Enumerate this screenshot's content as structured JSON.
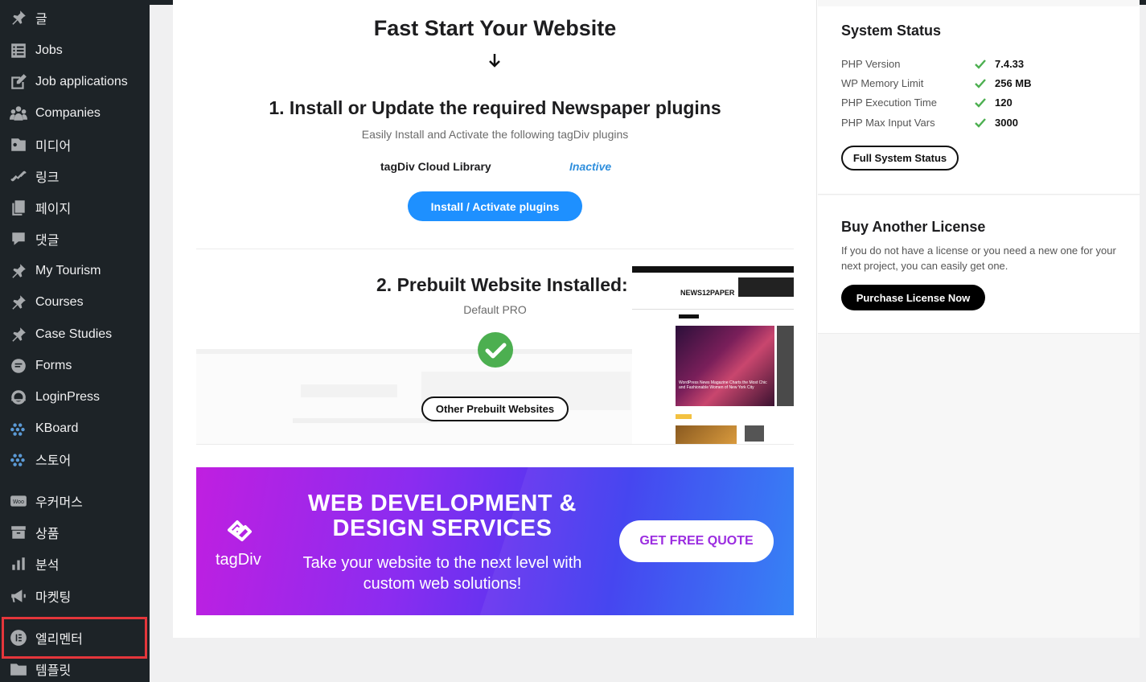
{
  "sidebar": {
    "items": [
      {
        "label": "글",
        "icon": "pin-icon"
      },
      {
        "label": "Jobs",
        "icon": "list-icon"
      },
      {
        "label": "Job applications",
        "icon": "edit-icon"
      },
      {
        "label": "Companies",
        "icon": "groups-icon"
      },
      {
        "label": "미디어",
        "icon": "media-icon"
      },
      {
        "label": "링크",
        "icon": "link-icon"
      },
      {
        "label": "페이지",
        "icon": "pages-icon"
      },
      {
        "label": "댓글",
        "icon": "comment-icon"
      },
      {
        "label": "My Tourism",
        "icon": "pin-icon"
      },
      {
        "label": "Courses",
        "icon": "pin-icon"
      },
      {
        "label": "Case Studies",
        "icon": "pin-icon"
      },
      {
        "label": "Forms",
        "icon": "forms-icon"
      },
      {
        "label": "LoginPress",
        "icon": "loginpress-icon"
      },
      {
        "label": "KBoard",
        "icon": "dots-icon"
      },
      {
        "label": "스토어",
        "icon": "dots-icon"
      },
      {
        "label": "우커머스",
        "icon": "woo-icon"
      },
      {
        "label": "상품",
        "icon": "archive-icon"
      },
      {
        "label": "분석",
        "icon": "chart-icon"
      },
      {
        "label": "마켓팅",
        "icon": "megaphone-icon"
      },
      {
        "label": "엘리멘터",
        "icon": "elementor-icon"
      },
      {
        "label": "템플릿",
        "icon": "folder-icon"
      }
    ]
  },
  "main": {
    "heading": "Fast Start Your Website",
    "step1": {
      "title": "1. Install or Update the required Newspaper plugins",
      "subtitle": "Easily Install and Activate the following tagDiv plugins",
      "plugin_name": "tagDiv Cloud Library",
      "plugin_status": "Inactive",
      "button": "Install / Activate plugins"
    },
    "step2": {
      "title": "2. Prebuilt Website Installed:",
      "subtitle": "Default PRO",
      "button": "Other Prebuilt Websites",
      "preview_logo": "NEWS12PAPER",
      "preview_headline": "WordPress News Magazine Charts the Most Chic and Fashionable Women of New York City"
    },
    "banner": {
      "logo_text": "tagDiv",
      "title": "WEB DEVELOPMENT & DESIGN SERVICES",
      "subtitle": "Take your website to the next level with custom web solutions!",
      "button": "GET FREE QUOTE"
    }
  },
  "right": {
    "system_status": {
      "title": "System Status",
      "rows": [
        {
          "label": "PHP Version",
          "value": "7.4.33"
        },
        {
          "label": "WP Memory Limit",
          "value": "256 MB"
        },
        {
          "label": "PHP Execution Time",
          "value": "120"
        },
        {
          "label": "PHP Max Input Vars",
          "value": "3000"
        }
      ],
      "button": "Full System Status"
    },
    "license": {
      "title": "Buy Another License",
      "text": "If you do not have a license or you need a new one for your next project, you can easily get one.",
      "button": "Purchase License Now"
    }
  },
  "colors": {
    "sidebar_bg": "#1d2327",
    "primary_button": "#1e90ff",
    "check_green": "#4caf50",
    "highlight_red": "#e5363b",
    "inactive_blue": "#2f8fdd"
  }
}
